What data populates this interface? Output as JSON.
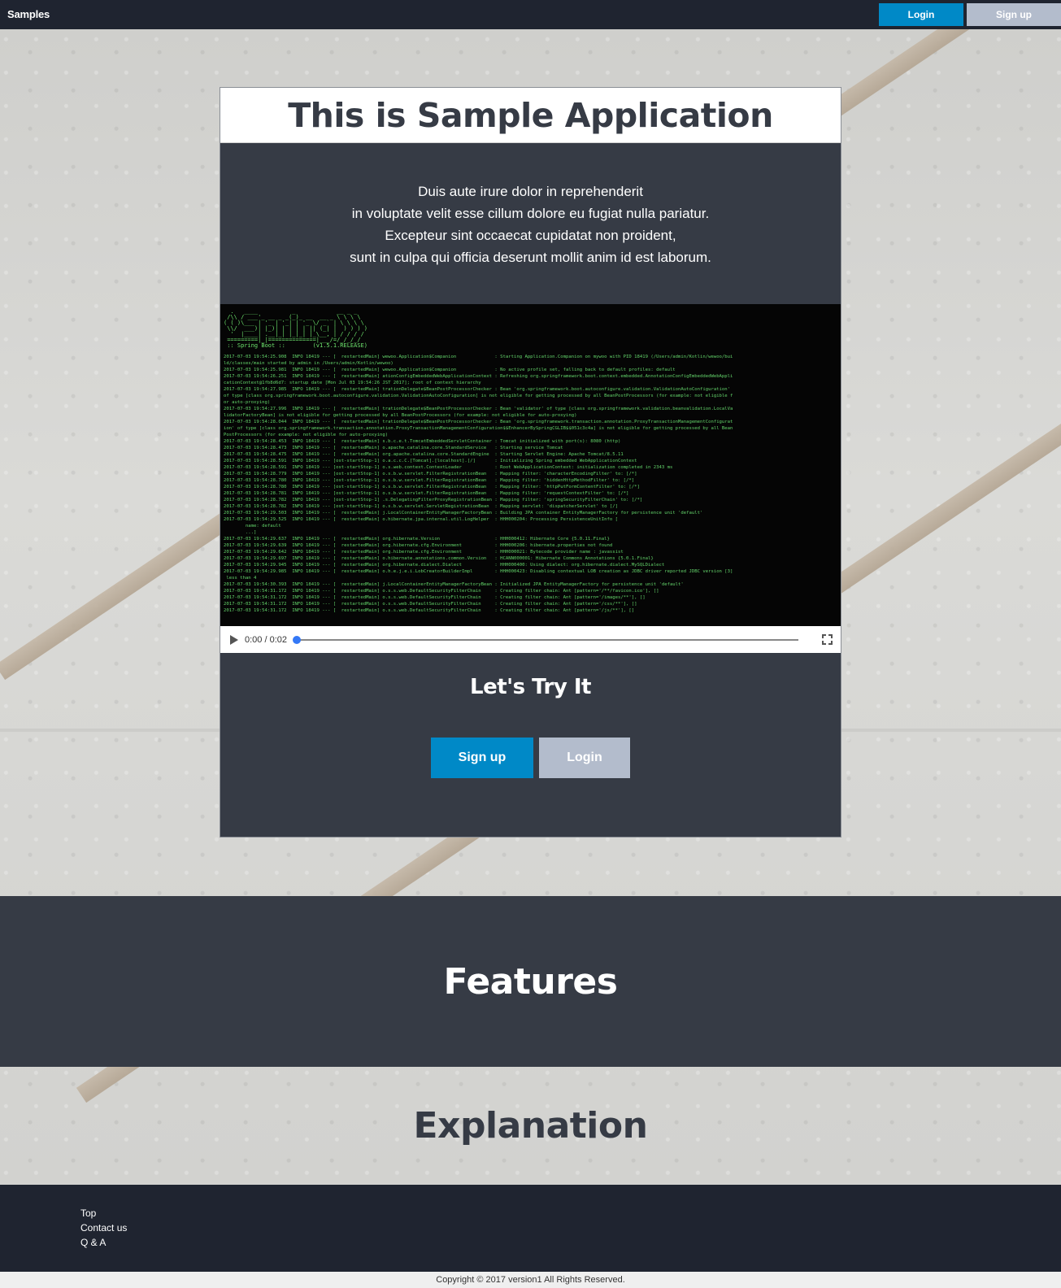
{
  "navbar": {
    "brand": "Samples",
    "login_label": "Login",
    "signup_label": "Sign up"
  },
  "hero": {
    "title": "This is Sample Application",
    "intro_lines": [
      "Duis aute irure dolor in reprehenderit",
      "in voluptate velit esse cillum dolore eu fugiat nulla pariatur.",
      "Excepteur sint occaecat cupidatat non proident,",
      "sunt in culpa qui officia deserunt mollit anim id est laborum."
    ]
  },
  "video": {
    "time": "0:00 / 0:02",
    "progress": 0,
    "spring_version": " :: Spring Boot ::        (v1.5.1.RELEASE)",
    "log_lines": [
      "2017-07-03 19:54:25.908  INFO 18419 --- [  restartedMain] wewoo.Application$Companion              : Starting Application.Companion on mywoo with PID 18419 (/Users/admin/Kotlin/wewoo/bui",
      "ld/classes/main started by admin in /Users/admin/Kotlin/wewoo)",
      "2017-07-03 19:54:25.981  INFO 18419 --- [  restartedMain] wewoo.Application$Companion              : No active profile set, falling back to default profiles: default",
      "2017-07-03 19:54:26.251  INFO 18419 --- [  restartedMain] ationConfigEmbeddedWebApplicationContext : Refreshing org.springframework.boot.context.embedded.AnnotationConfigEmbeddedWebAppli",
      "cationContext@1fb8d6d7: startup date [Mon Jul 03 19:54:26 JST 2017]; root of context hierarchy",
      "2017-07-03 19:54:27.985  INFO 18419 --- [  restartedMain] trationDelegate$BeanPostProcessorChecker : Bean 'org.springframework.boot.autoconfigure.validation.ValidationAutoConfiguration'",
      "of type [class org.springframework.boot.autoconfigure.validation.ValidationAutoConfiguration] is not eligible for getting processed by all BeanPostProcessors (for example: not eligible f",
      "or auto-proxying)",
      "2017-07-03 19:54:27.996  INFO 18419 --- [  restartedMain] trationDelegate$BeanPostProcessorChecker : Bean 'validator' of type [class org.springframework.validation.beanvalidation.LocalVa",
      "lidatorFactoryBean] is not eligible for getting processed by all BeanPostProcessors (for example: not eligible for auto-proxying)",
      "2017-07-03 19:54:28.044  INFO 18419 --- [  restartedMain] trationDelegate$BeanPostProcessorChecker : Bean 'org.springframework.transaction.annotation.ProxyTransactionManagementConfigurat",
      "ion' of type [class org.springframework.transaction.annotation.ProxyTransactionManagementConfiguration$$EnhancerBySpringCGLIB$$051c3c4a] is not eligible for getting processed by all Bean",
      "PostProcessors (for example: not eligible for auto-proxying)",
      "2017-07-03 19:54:28.453  INFO 18419 --- [  restartedMain] s.b.c.e.t.TomcatEmbeddedServletContainer : Tomcat initialized with port(s): 8080 (http)",
      "2017-07-03 19:54:28.473  INFO 18419 --- [  restartedMain] o.apache.catalina.core.StandardService   : Starting service Tomcat",
      "2017-07-03 19:54:28.475  INFO 18419 --- [  restartedMain] org.apache.catalina.core.StandardEngine  : Starting Servlet Engine: Apache Tomcat/8.5.11",
      "2017-07-03 19:54:28.591  INFO 18419 --- [ost-startStop-1] o.a.c.c.C.[Tomcat].[localhost].[/]       : Initializing Spring embedded WebApplicationContext",
      "2017-07-03 19:54:28.591  INFO 18419 --- [ost-startStop-1] o.s.web.context.ContextLoader            : Root WebApplicationContext: initialization completed in 2343 ms",
      "2017-07-03 19:54:28.779  INFO 18419 --- [ost-startStop-1] o.s.b.w.servlet.FilterRegistrationBean   : Mapping filter: 'characterEncodingFilter' to: [/*]",
      "2017-07-03 19:54:28.780  INFO 18419 --- [ost-startStop-1] o.s.b.w.servlet.FilterRegistrationBean   : Mapping filter: 'hiddenHttpMethodFilter' to: [/*]",
      "2017-07-03 19:54:28.780  INFO 18419 --- [ost-startStop-1] o.s.b.w.servlet.FilterRegistrationBean   : Mapping filter: 'httpPutFormContentFilter' to: [/*]",
      "2017-07-03 19:54:28.781  INFO 18419 --- [ost-startStop-1] o.s.b.w.servlet.FilterRegistrationBean   : Mapping filter: 'requestContextFilter' to: [/*]",
      "2017-07-03 19:54:28.782  INFO 18419 --- [ost-startStop-1] .s.DelegatingFilterProxyRegistrationBean : Mapping filter: 'springSecurityFilterChain' to: [/*]",
      "2017-07-03 19:54:28.782  INFO 18419 --- [ost-startStop-1] o.s.b.w.servlet.ServletRegistrationBean  : Mapping servlet: 'dispatcherServlet' to [/]",
      "2017-07-03 19:54:29.503  INFO 18419 --- [  restartedMain] j.LocalContainerEntityManagerFactoryBean : Building JPA container EntityManagerFactory for persistence unit 'default'",
      "2017-07-03 19:54:29.525  INFO 18419 --- [  restartedMain] o.hibernate.jpa.internal.util.LogHelper  : HHH000204: Processing PersistenceUnitInfo [",
      "        name: default",
      "        ...]",
      "2017-07-03 19:54:29.637  INFO 18419 --- [  restartedMain] org.hibernate.Version                    : HHH000412: Hibernate Core {5.0.11.Final}",
      "2017-07-03 19:54:29.639  INFO 18419 --- [  restartedMain] org.hibernate.cfg.Environment            : HHH000206: hibernate.properties not found",
      "2017-07-03 19:54:29.642  INFO 18419 --- [  restartedMain] org.hibernate.cfg.Environment            : HHH000021: Bytecode provider name : javassist",
      "2017-07-03 19:54:29.697  INFO 18419 --- [  restartedMain] o.hibernate.annotations.common.Version   : HCANN000001: Hibernate Commons Annotations {5.0.1.Final}",
      "2017-07-03 19:54:29.945  INFO 18419 --- [  restartedMain] org.hibernate.dialect.Dialect            : HHH000400: Using dialect: org.hibernate.dialect.MySQLDialect",
      "2017-07-03 19:54:29.985  INFO 18419 --- [  restartedMain] o.h.e.j.e.i.LobCreatorBuilderImpl        : HHH000423: Disabling contextual LOB creation as JDBC driver reported JDBC version [3]",
      " less than 4",
      "2017-07-03 19:54:30.393  INFO 18419 --- [  restartedMain] j.LocalContainerEntityManagerFactoryBean : Initialized JPA EntityManagerFactory for persistence unit 'default'",
      "2017-07-03 19:54:31.172  INFO 18419 --- [  restartedMain] o.s.s.web.DefaultSecurityFilterChain     : Creating filter chain: Ant [pattern='/**/favicon.ico'], []",
      "2017-07-03 19:54:31.172  INFO 18419 --- [  restartedMain] o.s.s.web.DefaultSecurityFilterChain     : Creating filter chain: Ant [pattern='/images/**'], []",
      "2017-07-03 19:54:31.172  INFO 18419 --- [  restartedMain] o.s.s.web.DefaultSecurityFilterChain     : Creating filter chain: Ant [pattern='/css/**'], []",
      "2017-07-03 19:54:31.172  INFO 18419 --- [  restartedMain] o.s.s.web.DefaultSecurityFilterChain     : Creating filter chain: Ant [pattern='/js/**'], []"
    ]
  },
  "cta": {
    "title": "Let's Try It",
    "signup_label": "Sign up",
    "login_label": "Login"
  },
  "sections": {
    "features": "Features",
    "explanation": "Explanation"
  },
  "footer": {
    "links": [
      "Top",
      "Contact us",
      "Q & A"
    ],
    "copyright": "Copyright © 2017 version1 All Rights Reserved."
  },
  "colors": {
    "primary": "#0089c7",
    "secondary": "#b3bccc",
    "dark": "#363b45",
    "navbar": "#1f2430"
  }
}
